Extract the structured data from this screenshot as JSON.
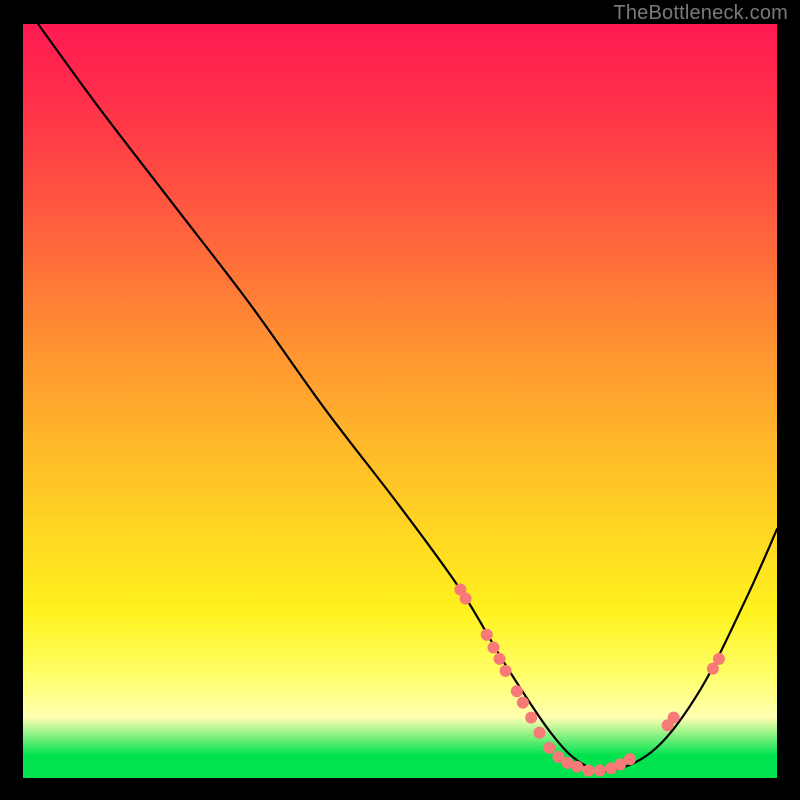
{
  "attribution": "TheBottleneck.com",
  "chart_data": {
    "type": "line",
    "title": "",
    "xlabel": "",
    "ylabel": "",
    "xlim": [
      0,
      100
    ],
    "ylim": [
      0,
      100
    ],
    "series": [
      {
        "name": "bottleneck-curve",
        "x": [
          2,
          10,
          20,
          30,
          40,
          50,
          58,
          64,
          70,
          74,
          78,
          84,
          90,
          96,
          100
        ],
        "y": [
          100,
          89,
          76,
          63,
          49,
          36,
          25,
          15,
          6,
          2,
          1,
          4,
          12,
          24,
          33
        ]
      }
    ],
    "markers": [
      {
        "x": 58.0,
        "y": 25.0
      },
      {
        "x": 58.7,
        "y": 23.8
      },
      {
        "x": 61.5,
        "y": 19.0
      },
      {
        "x": 62.4,
        "y": 17.3
      },
      {
        "x": 63.2,
        "y": 15.8
      },
      {
        "x": 64.0,
        "y": 14.2
      },
      {
        "x": 65.5,
        "y": 11.5
      },
      {
        "x": 66.3,
        "y": 10.0
      },
      {
        "x": 67.4,
        "y": 8.0
      },
      {
        "x": 68.5,
        "y": 6.0
      },
      {
        "x": 69.8,
        "y": 4.0
      },
      {
        "x": 71.0,
        "y": 2.8
      },
      {
        "x": 72.2,
        "y": 2.0
      },
      {
        "x": 73.5,
        "y": 1.5
      },
      {
        "x": 75.0,
        "y": 1.0
      },
      {
        "x": 76.5,
        "y": 1.0
      },
      {
        "x": 78.0,
        "y": 1.3
      },
      {
        "x": 79.2,
        "y": 1.8
      },
      {
        "x": 80.5,
        "y": 2.5
      },
      {
        "x": 85.5,
        "y": 7.0
      },
      {
        "x": 86.3,
        "y": 8.0
      },
      {
        "x": 91.5,
        "y": 14.5
      },
      {
        "x": 92.3,
        "y": 15.8
      }
    ],
    "marker_color": "#f77a78",
    "curve_color": "#000000",
    "gradient_stops": [
      {
        "pos": 0,
        "color": "#ff1a52"
      },
      {
        "pos": 25,
        "color": "#ff5a3f"
      },
      {
        "pos": 55,
        "color": "#ffb62a"
      },
      {
        "pos": 78,
        "color": "#fff21e"
      },
      {
        "pos": 92,
        "color": "#ffffb0"
      },
      {
        "pos": 97,
        "color": "#00e24e"
      },
      {
        "pos": 100,
        "color": "#00e24e"
      }
    ]
  }
}
